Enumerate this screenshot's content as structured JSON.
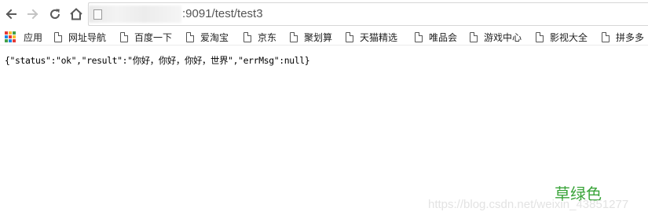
{
  "browser": {
    "url": ":9091/test/test3",
    "icons": {
      "back": "arrow-left-icon",
      "forward": "arrow-right-icon",
      "reload": "reload-icon",
      "home": "home-icon",
      "page": "page-icon"
    }
  },
  "bookmarks": {
    "items": [
      {
        "label": "应用",
        "icon": "apps-grid-icon"
      },
      {
        "label": "网址导航",
        "icon": "document-icon"
      },
      {
        "label": "百度一下",
        "icon": "document-icon"
      },
      {
        "label": "爱淘宝",
        "icon": "document-icon"
      },
      {
        "label": "京东",
        "icon": "document-icon"
      },
      {
        "label": "聚划算",
        "icon": "document-icon"
      },
      {
        "label": "天猫精选",
        "icon": "document-icon"
      },
      {
        "label": "唯品会",
        "icon": "document-icon"
      },
      {
        "label": "游戏中心",
        "icon": "document-icon"
      },
      {
        "label": "影视大全",
        "icon": "document-icon"
      },
      {
        "label": "拼多多",
        "icon": "document-icon"
      }
    ]
  },
  "content": {
    "json_response": "{\"status\":\"ok\",\"result\":\"你好，你好，你好，世界\",\"errMsg\":null}"
  },
  "watermark": {
    "color_label": "草绿色",
    "url": "https://blog.csdn.net/weixin_43851277"
  },
  "colors": {
    "watermark_green": "#3aa43a",
    "apps_grid": [
      "#e53935",
      "#fbc02d",
      "#43a047",
      "#1e88e5",
      "#e53935",
      "#fbc02d",
      "#43a047",
      "#1e88e5",
      "#e53935"
    ]
  }
}
